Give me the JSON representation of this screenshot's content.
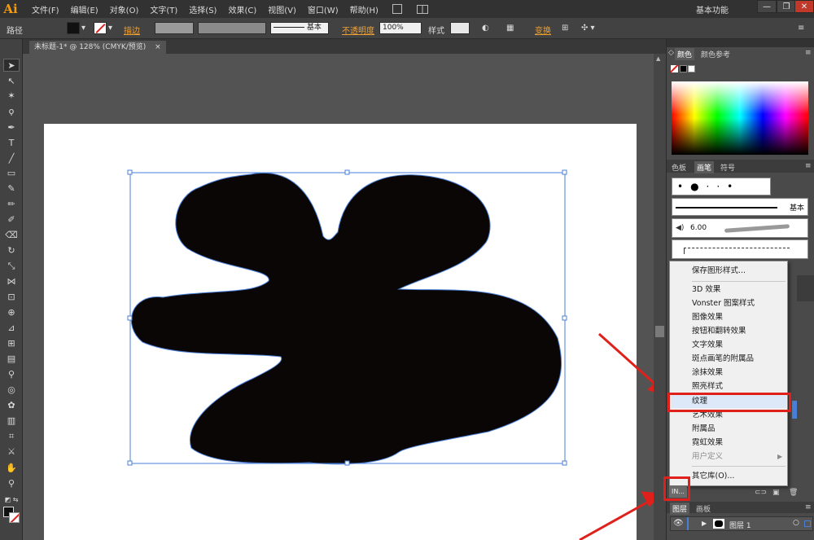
{
  "menubar": {
    "logo": "Ai",
    "items": [
      "文件(F)",
      "编辑(E)",
      "对象(O)",
      "文字(T)",
      "选择(S)",
      "效果(C)",
      "视图(V)",
      "窗口(W)",
      "帮助(H)"
    ],
    "workspace": "基本功能"
  },
  "controlbar": {
    "selection": "路径",
    "stroke_label": "描边",
    "brush_name": "基本",
    "opacity_label": "不透明度",
    "opacity_value": "100%",
    "style_label": "样式",
    "transform_label": "变换"
  },
  "document": {
    "tab_title": "未标题-1* @ 128% (CMYK/预览)",
    "close_glyph": "×"
  },
  "panels": {
    "color_tabs": [
      "颜色",
      "颜色参考"
    ],
    "swatch_tabs": [
      "色板",
      "画笔",
      "符号"
    ],
    "brush_basic": "基本",
    "brush_size": "6.00",
    "layers_tabs": [
      "图层",
      "画板"
    ],
    "layer_name": "图层 1"
  },
  "dropdown": {
    "items": [
      {
        "label": "保存图形样式...",
        "disabled": false
      },
      {
        "label": "3D 效果",
        "disabled": false
      },
      {
        "label": "Vonster 图案样式",
        "disabled": false
      },
      {
        "label": "图像效果",
        "disabled": false
      },
      {
        "label": "按钮和翻转效果",
        "disabled": false
      },
      {
        "label": "文字效果",
        "disabled": false
      },
      {
        "label": "斑点画笔的附属品",
        "disabled": false
      },
      {
        "label": "涂抹效果",
        "disabled": false
      },
      {
        "label": "照亮样式",
        "disabled": false
      },
      {
        "label": "纹理",
        "disabled": false,
        "highlighted": true
      },
      {
        "label": "艺术效果",
        "disabled": false
      },
      {
        "label": "附属品",
        "disabled": false
      },
      {
        "label": "霓虹效果",
        "disabled": false
      },
      {
        "label": "用户定义",
        "disabled": true
      },
      {
        "label": "其它库(O)...",
        "disabled": false
      }
    ],
    "library_button": "IN..."
  },
  "colors": {
    "accent_orange": "#f0a030",
    "annotation_red": "#e0201a",
    "shape_fill": "#0a0606",
    "selection_blue": "#4a7fd8"
  }
}
